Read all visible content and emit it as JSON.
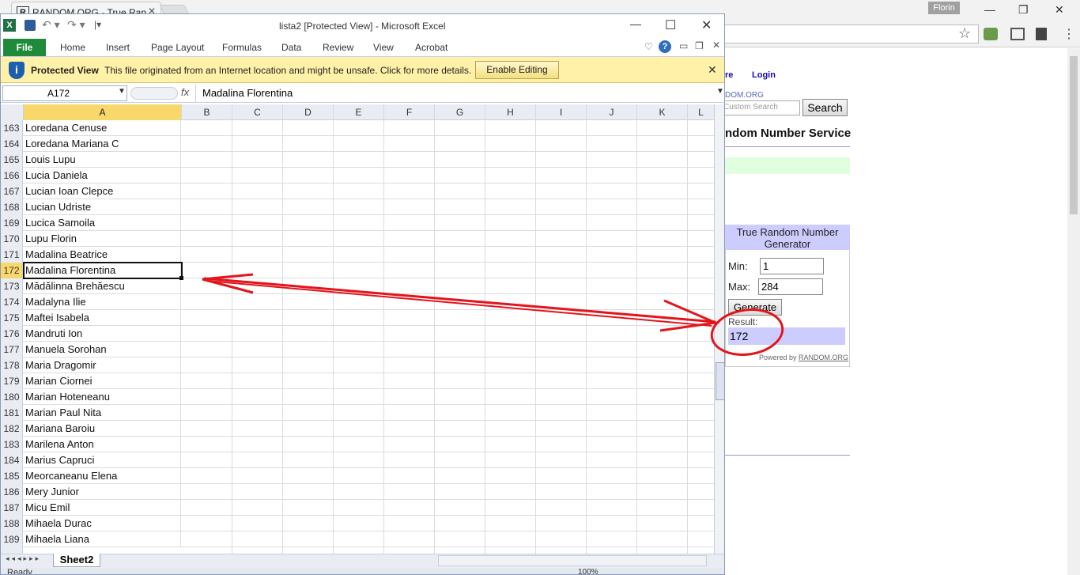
{
  "chrome": {
    "tab_title": "RANDOM.ORG - True Ran",
    "tab_favicon": "R",
    "user": "Florin",
    "icons": [
      "star-icon",
      "extension-icon",
      "cast-icon",
      "menu-icon"
    ]
  },
  "excel": {
    "window_title": "lista2  [Protected View]  -  Microsoft Excel",
    "file_tab": "File",
    "ribbon_tabs": [
      "Home",
      "Insert",
      "Page Layout",
      "Formulas",
      "Data",
      "Review",
      "View",
      "Acrobat"
    ],
    "protected_view": {
      "title": "Protected View",
      "message": "This file originated from an Internet location and might be unsafe. Click for more details.",
      "button": "Enable Editing"
    },
    "name_box": "A172",
    "fx": "fx",
    "formula": "Madalina Florentina",
    "columns": [
      "A",
      "B",
      "C",
      "D",
      "E",
      "F",
      "G",
      "H",
      "I",
      "J",
      "K",
      "L"
    ],
    "rows": [
      {
        "n": "163",
        "a": "Loredana Cenuse"
      },
      {
        "n": "164",
        "a": "Loredana Mariana C"
      },
      {
        "n": "165",
        "a": "Louis Lupu"
      },
      {
        "n": "166",
        "a": "Lucia Daniela"
      },
      {
        "n": "167",
        "a": "Lucian Ioan Clepce"
      },
      {
        "n": "168",
        "a": "Lucian Udriste"
      },
      {
        "n": "169",
        "a": "Lucica Samoila"
      },
      {
        "n": "170",
        "a": "Lupu Florin"
      },
      {
        "n": "171",
        "a": "Madalina Beatrice"
      },
      {
        "n": "172",
        "a": "Madalina Florentina"
      },
      {
        "n": "173",
        "a": "Mădălinna Brehăescu"
      },
      {
        "n": "174",
        "a": "Madalyna Ilie"
      },
      {
        "n": "175",
        "a": "Maftei Isabela"
      },
      {
        "n": "176",
        "a": "Mandruti Ion"
      },
      {
        "n": "177",
        "a": "Manuela Sorohan"
      },
      {
        "n": "178",
        "a": "Maria Dragomir"
      },
      {
        "n": "179",
        "a": "Marian Ciornei"
      },
      {
        "n": "180",
        "a": "Marian Hoteneanu"
      },
      {
        "n": "181",
        "a": "Marian Paul Nita"
      },
      {
        "n": "182",
        "a": "Mariana Baroiu"
      },
      {
        "n": "183",
        "a": "Marilena Anton"
      },
      {
        "n": "184",
        "a": "Marius Capruci"
      },
      {
        "n": "185",
        "a": "Meorcaneanu Elena"
      },
      {
        "n": "186",
        "a": "Mery Junior"
      },
      {
        "n": "187",
        "a": "Micu Emil"
      },
      {
        "n": "188",
        "a": "Mihaela Durac"
      },
      {
        "n": "189",
        "a": "Mihaela Liana"
      }
    ],
    "sheet_tab": "Sheet2",
    "status": "Ready",
    "zoom": "100%"
  },
  "random_org": {
    "nav_link_partial": "re",
    "login": "Login",
    "logo_partial": "DOM.ORG",
    "search_placeholder": "Custom Search",
    "search_button": "Search",
    "service_title": "ndom Number Service",
    "widget_title": "True Random Number Generator",
    "min_label": "Min:",
    "min_value": "1",
    "max_label": "Max:",
    "max_value": "284",
    "generate": "Generate",
    "result_label": "Result:",
    "result_value": "172",
    "powered_by": "Powered by",
    "powered_link": "RANDOM.ORG"
  },
  "colors": {
    "excel_green": "#1e8a3a",
    "protected_bar": "#fff1a8",
    "selection_header": "#f9d86b",
    "widget_purple": "#ccccff",
    "annotation_red": "#e3141c"
  }
}
